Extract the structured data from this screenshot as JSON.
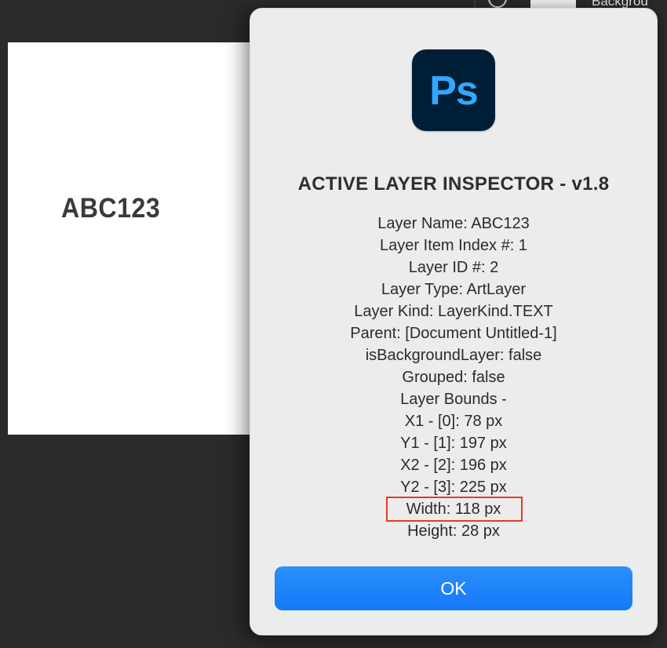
{
  "canvas": {
    "text": "ABC123"
  },
  "topbar": {
    "label": "Backgrou"
  },
  "dialog": {
    "app_icon": "Ps",
    "title": "ACTIVE LAYER INSPECTOR - v1.8",
    "info": [
      "Layer Name: ABC123",
      "Layer Item Index #: 1",
      "Layer ID #: 2",
      "Layer Type: ArtLayer",
      "Layer Kind: LayerKind.TEXT",
      "Parent: [Document Untitled-1]",
      "isBackgroundLayer: false",
      "Grouped: false",
      "Layer Bounds -",
      "X1 - [0]: 78 px",
      "Y1 - [1]: 197 px",
      "X2 - [2]: 196 px",
      "Y2 - [3]: 225 px",
      "Width: 118 px",
      "Height: 28 px"
    ],
    "ok_label": "OK"
  },
  "colors": {
    "ok_button": "#1a7ff8",
    "highlight": "#e53a28",
    "ps_icon_bg": "#001e36",
    "ps_icon_text": "#31a8ff"
  }
}
